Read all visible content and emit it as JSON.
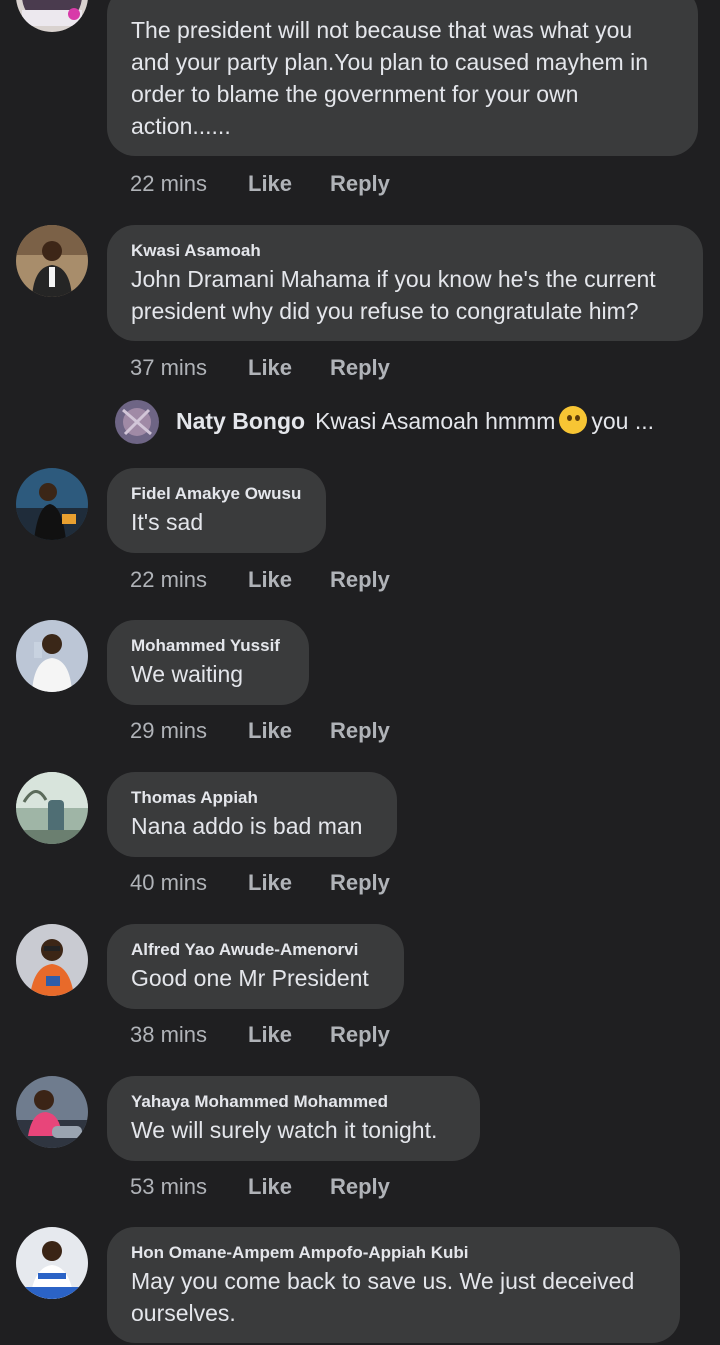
{
  "comments": [
    {
      "author": "",
      "text": "The president will not because that was what you and your party plan.You plan  to caused mayhem in order to blame the government for your own action......",
      "time": "22 mins",
      "like": "Like",
      "reply": "Reply"
    },
    {
      "author": "Kwasi Asamoah",
      "text": "John Dramani Mahama if you know he's the current president why did you refuse to congratulate him?",
      "time": "37 mins",
      "like": "Like",
      "reply": "Reply"
    },
    {
      "author": "Fidel Amakye Owusu",
      "text": "It's sad",
      "time": "22 mins",
      "like": "Like",
      "reply": "Reply"
    },
    {
      "author": "Mohammed Yussif",
      "text": "We waiting",
      "time": "29 mins",
      "like": "Like",
      "reply": "Reply"
    },
    {
      "author": "Thomas Appiah",
      "text": "Nana addo is bad man",
      "time": "40 mins",
      "like": "Like",
      "reply": "Reply"
    },
    {
      "author": "Alfred Yao Awude-Amenorvi",
      "text": "Good one Mr President",
      "time": "38 mins",
      "like": "Like",
      "reply": "Reply"
    },
    {
      "author": "Yahaya Mohammed Mohammed",
      "text": "We will surely watch it tonight.",
      "time": "53 mins",
      "like": "Like",
      "reply": "Reply"
    },
    {
      "author": "Hon Omane-Ampem Ampofo-Appiah Kubi",
      "text": "May you come back to save us. We just deceived ourselves.",
      "time": "",
      "like": "",
      "reply": ""
    }
  ],
  "reply_preview": {
    "name": "Naty Bongo",
    "text_before": "Kwasi Asamoah hmmm",
    "emoji": "thinking-face",
    "text_after": "you ..."
  },
  "colors": {
    "background": "#1f1f21",
    "bubble": "#3a3b3c",
    "primary_text": "#e4e6eb",
    "secondary_text": "#b0b3b8"
  }
}
